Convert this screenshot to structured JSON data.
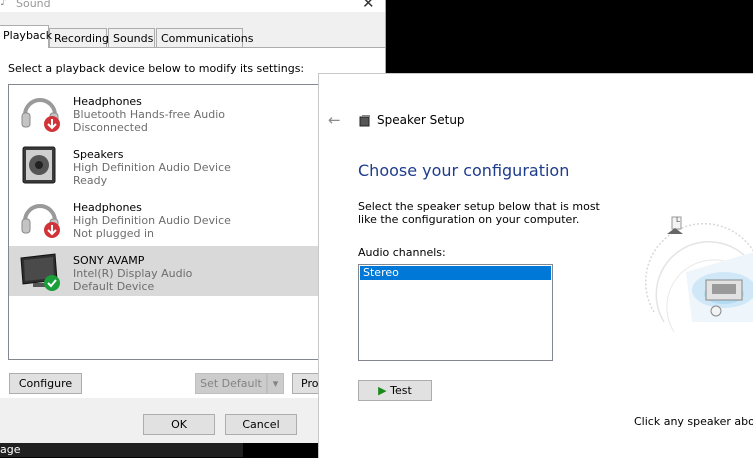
{
  "sound_dialog": {
    "title": "Sound",
    "tabs": [
      "Playback",
      "Recording",
      "Sounds",
      "Communications"
    ],
    "instruction": "Select a playback device below to modify its settings:",
    "devices": [
      {
        "name": "Headphones",
        "description": "Bluetooth Hands-free Audio",
        "status": "Disconnected",
        "icon": "headphones-icon"
      },
      {
        "name": "Speakers",
        "description": "High Definition Audio Device",
        "status": "Ready",
        "icon": "speaker-icon"
      },
      {
        "name": "Headphones",
        "description": "High Definition Audio Device",
        "status": "Not plugged in",
        "icon": "headphones-icon"
      },
      {
        "name": "SONY AVAMP",
        "description": "Intel(R) Display Audio",
        "status": "Default Device",
        "icon": "monitor-icon"
      }
    ],
    "buttons": {
      "configure": "Configure",
      "set_default": "Set Default",
      "properties": "Pro",
      "ok": "OK",
      "cancel": "Cancel"
    },
    "taskbar_text": "age"
  },
  "speaker_setup": {
    "title": "Speaker Setup",
    "heading": "Choose your configuration",
    "description": "Select the speaker setup below that is most like the configuration on your computer.",
    "channels_label": "Audio channels:",
    "channels": [
      "Stereo"
    ],
    "selected_channel": "Stereo",
    "test_button": "Test",
    "hint": "Click any speaker above",
    "speaker_marker": "L"
  },
  "colors": {
    "accent": "#0078d7",
    "heading": "#1e3c8c",
    "selected_row": "#d9d9d9",
    "ok_check": "#1a9e3a",
    "unplugged_badge": "#d13438"
  }
}
